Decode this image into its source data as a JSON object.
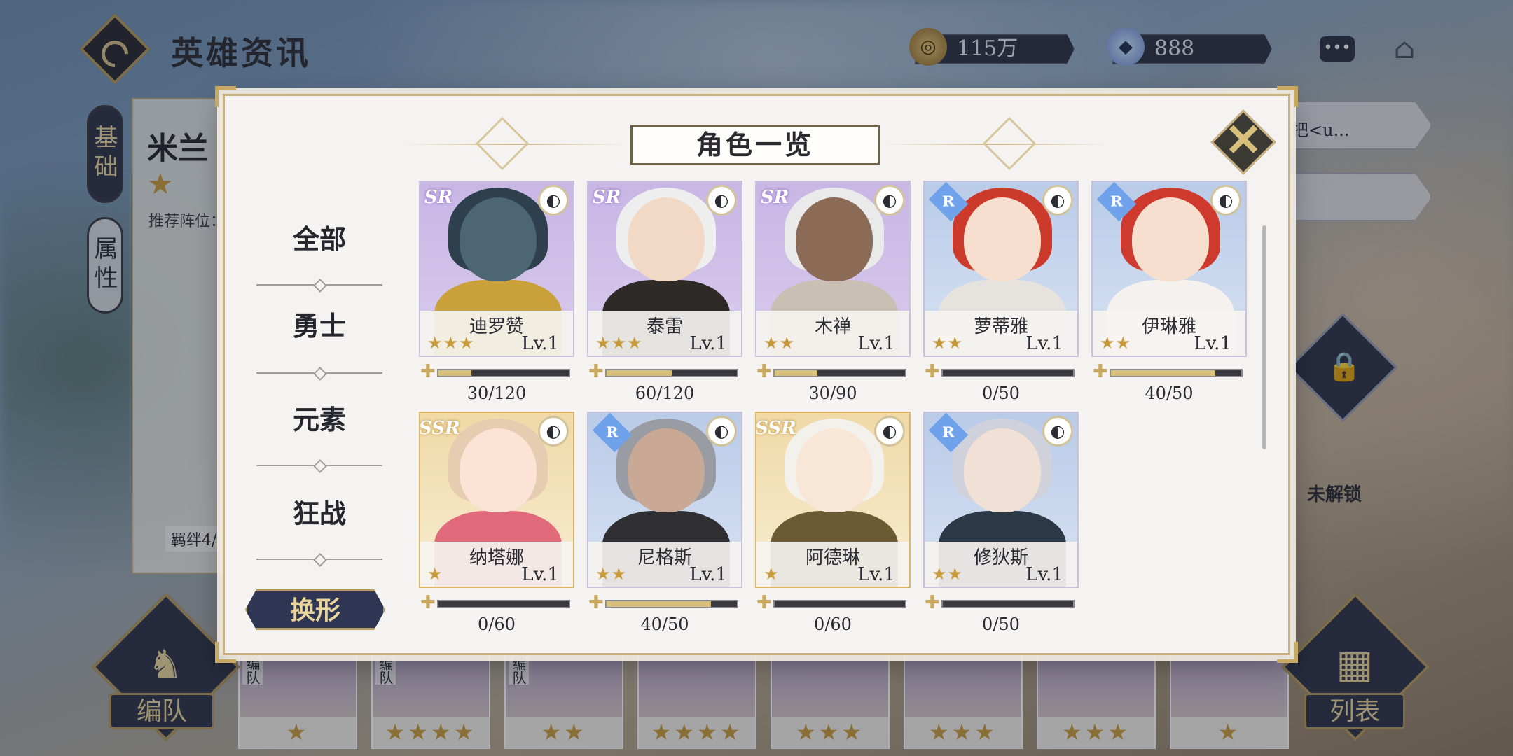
{
  "header": {
    "title": "英雄资讯",
    "gold": "115万",
    "gems": "888"
  },
  "background": {
    "tabs": [
      "基础",
      "属性"
    ],
    "hero_name": "米兰",
    "hero_star": "★",
    "recommend": "推荐阵位：",
    "bond": "羁绊4/",
    "formation_label": "编队",
    "list_label": "列表",
    "right_text": "把<u...",
    "unlock_label": "未解锁",
    "strip": [
      {
        "tag": "编队",
        "stars": "★"
      },
      {
        "tag": "编队",
        "stars": "★★★★"
      },
      {
        "tag": "编队",
        "stars": "★★"
      },
      {
        "tag": "",
        "stars": "★★★★"
      },
      {
        "tag": "",
        "stars": "★★★"
      },
      {
        "tag": "",
        "stars": "★★★"
      },
      {
        "tag": "",
        "stars": "★★★"
      },
      {
        "tag": "",
        "stars": "★"
      }
    ]
  },
  "modal": {
    "title": "角色一览",
    "filters": [
      "全部",
      "勇士",
      "元素",
      "狂战"
    ],
    "transform_label": "换形",
    "heroes": [
      {
        "name": "迪罗赞",
        "rarity": "SR",
        "stars": "★★★",
        "level": "Lv.1",
        "progress": "30/120",
        "fraction": 0.25,
        "skin": "#4c6674",
        "hair": "#2e3f4e",
        "body": "#c9a03a"
      },
      {
        "name": "泰雷",
        "rarity": "SR",
        "stars": "★★★",
        "level": "Lv.1",
        "progress": "60/120",
        "fraction": 0.5,
        "skin": "#f1d9c6",
        "hair": "#eeeeee",
        "body": "#2d2a28"
      },
      {
        "name": "木禅",
        "rarity": "SR",
        "stars": "★★",
        "level": "Lv.1",
        "progress": "30/90",
        "fraction": 0.333,
        "skin": "#8b6a56",
        "hair": "#eaeaea",
        "body": "#c9bfb3"
      },
      {
        "name": "萝蒂雅",
        "rarity": "R",
        "stars": "★★",
        "level": "Lv.1",
        "progress": "0/50",
        "fraction": 0,
        "skin": "#f6dfcf",
        "hair": "#cc3a2c",
        "body": "#e6e3de"
      },
      {
        "name": "伊琳雅",
        "rarity": "R",
        "stars": "★★",
        "level": "Lv.1",
        "progress": "40/50",
        "fraction": 0.8,
        "skin": "#f6dfcf",
        "hair": "#cf3a2e",
        "body": "#f4f1ee"
      },
      {
        "name": "纳塔娜",
        "rarity": "SSR",
        "stars": "★",
        "level": "Lv.1",
        "progress": "0/60",
        "fraction": 0,
        "skin": "#fbe3d6",
        "hair": "#e6ccb0",
        "body": "#e06a7a"
      },
      {
        "name": "尼格斯",
        "rarity": "R",
        "stars": "★★",
        "level": "Lv.1",
        "progress": "40/50",
        "fraction": 0.8,
        "skin": "#c9a896",
        "hair": "#9a9ca4",
        "body": "#2e2e33"
      },
      {
        "name": "阿德琳",
        "rarity": "SSR",
        "stars": "★",
        "level": "Lv.1",
        "progress": "0/60",
        "fraction": 0,
        "skin": "#f8e6d6",
        "hair": "#f3f1ec",
        "body": "#6b5a32"
      },
      {
        "name": "修狄斯",
        "rarity": "R",
        "stars": "★★",
        "level": "Lv.1",
        "progress": "0/50",
        "fraction": 0,
        "skin": "#f1e0d6",
        "hair": "#cfd2da",
        "body": "#2b3946"
      }
    ]
  },
  "colors": {
    "accent_gold": "#c9a862",
    "navy": "#2e3654"
  }
}
